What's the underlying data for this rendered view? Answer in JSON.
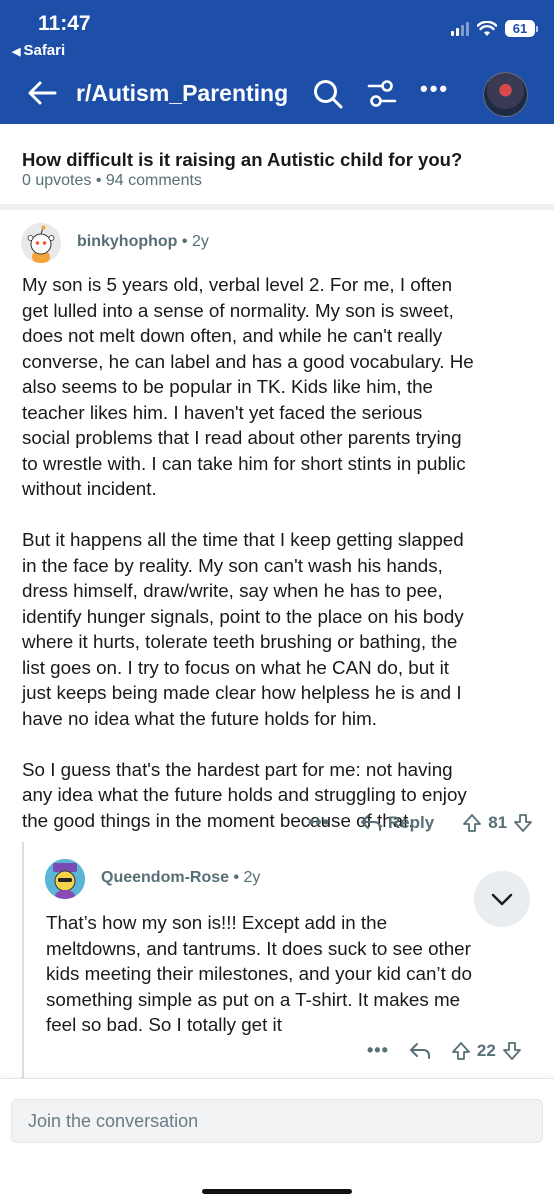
{
  "status_bar": {
    "time": "11:47",
    "back_app": "Safari",
    "battery": "61"
  },
  "nav": {
    "subreddit": "r/Autism_Parenting",
    "icons": [
      "back-arrow-icon",
      "search-icon",
      "filter-icon",
      "more-icon",
      "avatar"
    ],
    "more_label": "•••"
  },
  "post": {
    "title": "How difficult is it raising an Autistic child for you?",
    "meta": "0 upvotes • 94 comments"
  },
  "comments": [
    {
      "user": "binkyhophop",
      "age": "2y",
      "paragraphs": [
        [
          "My son is 5 years old, verbal level 2. For me, I often",
          "get lulled into a sense of normality. My son is sweet,",
          "does not melt down often, and while he can't really",
          "converse, he can label and has a good vocabulary. He",
          "also seems to be popular in TK. Kids like him, the",
          "teacher likes him. I haven't yet faced the serious",
          "social problems that I read about other parents trying",
          "to wrestle with. I can take him for short stints in public",
          "without incident."
        ],
        [
          "But it happens all the time that I keep getting slapped",
          "in the face by reality. My son can't wash his hands,",
          "dress himself, draw/write, say when he has to pee,",
          "identify hunger signals, point to the place on his body",
          "where it hurts, tolerate teeth brushing or bathing, the",
          "list goes on. I try to focus on what he CAN do, but it",
          "just keeps being made clear how helpless he is and I",
          "have no idea what the future holds for him."
        ],
        [
          "So I guess that's the hardest part for me: not having",
          "any idea what the future holds and struggling to enjoy",
          "the good things in the moment because of that."
        ]
      ],
      "more_label": "•••",
      "reply_label": "Reply",
      "votes": "81"
    },
    {
      "user": "Queendom-Rose",
      "age": "2y",
      "lines": [
        "That’s how my son is!!! Except add in the",
        "meltdowns, and tantrums. It does suck to see other",
        "kids meeting their milestones, and your kid can’t do",
        "something simple as put on a T-shirt. It makes me",
        "feel so bad. So I totally get it"
      ],
      "more_label": "•••",
      "votes": "22"
    }
  ],
  "composer": {
    "placeholder": "Join the conversation"
  },
  "colors": {
    "nav_blue": "#1d4fa8",
    "meta_gray": "#576f76"
  }
}
